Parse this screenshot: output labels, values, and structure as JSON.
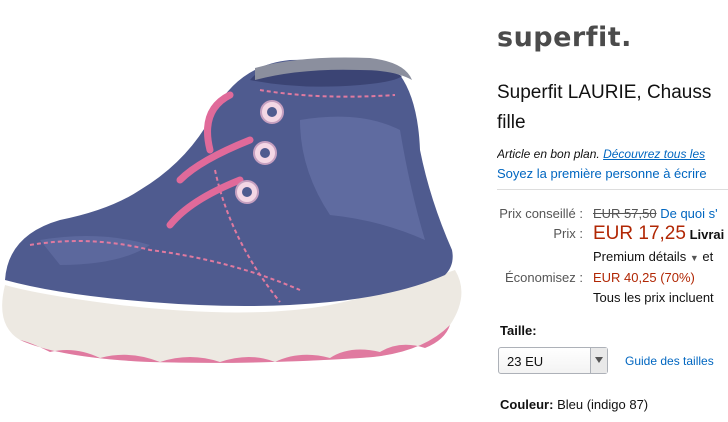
{
  "product": {
    "brand_logo": "superfit.",
    "title_line1": "Superfit LAURIE, Chauss",
    "title_line2": "fille",
    "deal_prefix": "Article en bon plan.",
    "deal_link": "Découvrez tous les",
    "review_link": "Soyez la première personne à écrire"
  },
  "pricing": {
    "list_label": "Prix conseillé :",
    "list_price": "EUR 57,50",
    "list_link": "De quoi s'",
    "price_label": "Prix :",
    "price": "EUR 17,25",
    "delivery": "Livrai",
    "premium_link": "Premium détails",
    "premium_suffix": "et",
    "savings_label": "Économisez :",
    "savings": "EUR 40,25 (70%)",
    "tax_note": "Tous les prix incluent"
  },
  "size": {
    "label": "Taille:",
    "selected": "23 EU",
    "guide_link": "Guide des tailles"
  },
  "color": {
    "label": "Couleur:",
    "value": "Bleu (indigo 87)"
  }
}
